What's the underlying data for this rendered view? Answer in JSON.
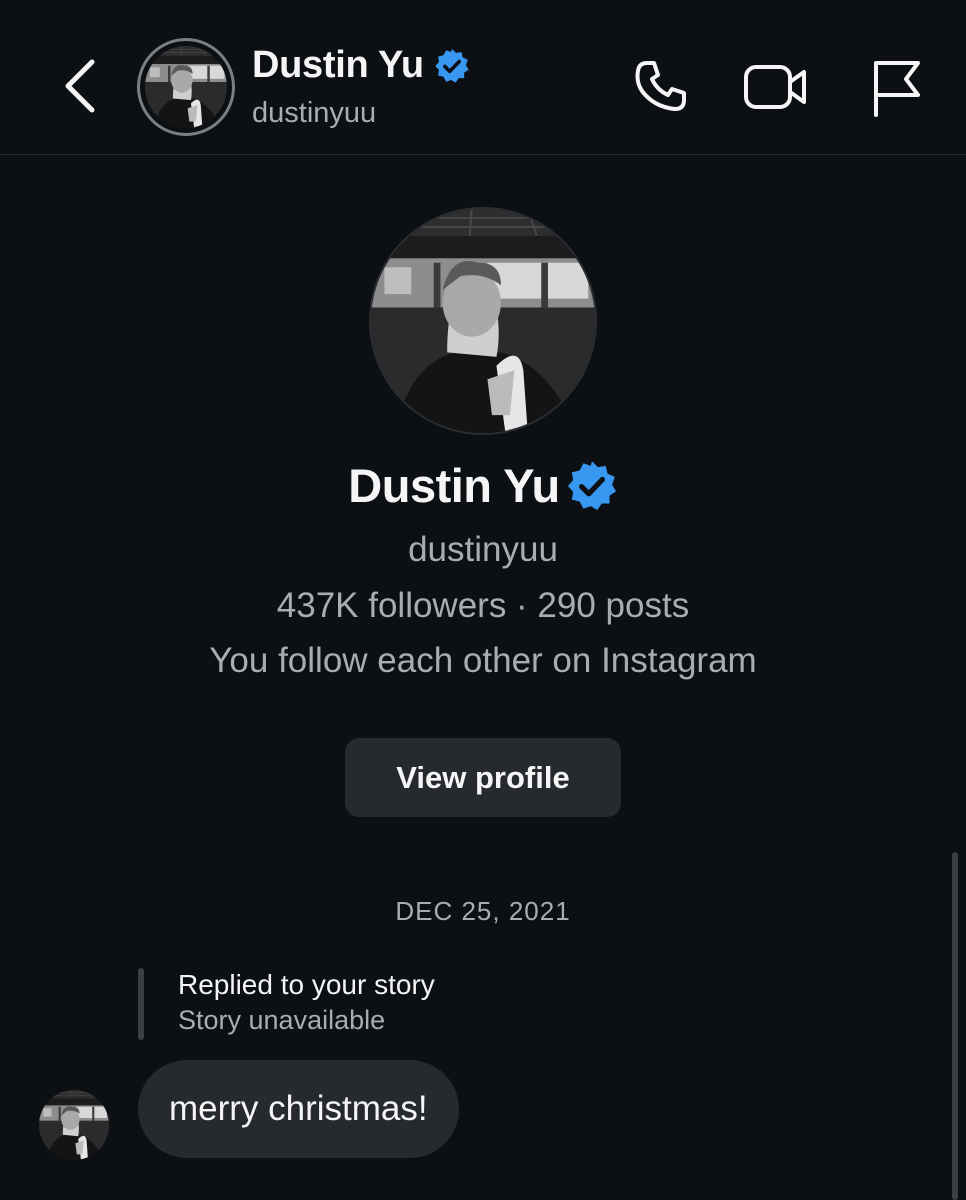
{
  "header": {
    "name": "Dustin Yu",
    "username": "dustinyuu",
    "verified": true,
    "icons": [
      "back-icon",
      "phone-icon",
      "video-icon",
      "flag-icon"
    ]
  },
  "profile": {
    "name": "Dustin Yu",
    "username": "dustinyuu",
    "stats": "437K followers · 290 posts",
    "mutual": "You follow each other on Instagram",
    "view_profile_label": "View profile"
  },
  "conversation": {
    "date": "DEC 25, 2021",
    "reply_title": "Replied to your story",
    "reply_subtitle": "Story unavailable",
    "message": "merry christmas!"
  },
  "colors": {
    "background": "#0c1014",
    "verified_badge": "#3897f0",
    "bubble": "#262a2f",
    "secondary_text": "#a8adb3"
  }
}
